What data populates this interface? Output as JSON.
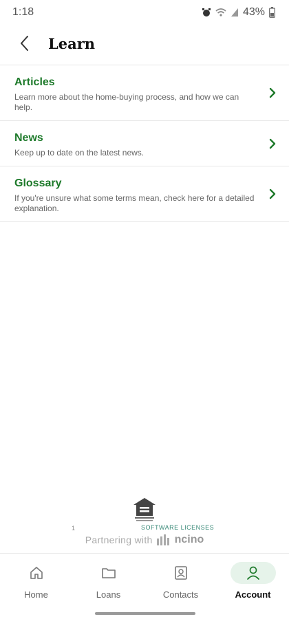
{
  "status_bar": {
    "time": "1:18",
    "battery": "43%"
  },
  "header": {
    "title": "Learn"
  },
  "menu": [
    {
      "title": "Articles",
      "description": "Learn more about the home-buying process, and how we can help."
    },
    {
      "title": "News",
      "description": "Keep up to date on the latest news."
    },
    {
      "title": "Glossary",
      "description": "If you're unsure what some terms mean, check here for a detailed explanation."
    }
  ],
  "footer": {
    "page_number": "1",
    "licenses_label": "SOFTWARE LICENSES",
    "partner_text": "Partnering with",
    "partner_brand": "ncino"
  },
  "bottom_nav": [
    {
      "label": "Home",
      "icon": "home-icon"
    },
    {
      "label": "Loans",
      "icon": "folder-icon"
    },
    {
      "label": "Contacts",
      "icon": "contact-card-icon"
    },
    {
      "label": "Account",
      "icon": "person-icon",
      "active": true
    }
  ],
  "colors": {
    "accent_green": "#1e7a2b",
    "active_nav_bg": "#e6f3ea",
    "licenses_teal": "#3a8a78"
  }
}
